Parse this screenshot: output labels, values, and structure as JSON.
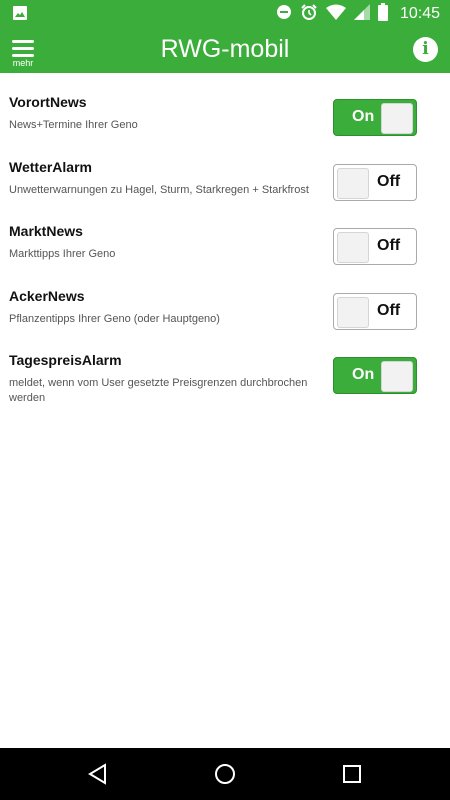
{
  "status_bar": {
    "time": "10:45",
    "icons": [
      "image-icon",
      "dnd-icon",
      "alarm-icon",
      "wifi-icon",
      "signal-icon",
      "battery-icon"
    ]
  },
  "app_bar": {
    "menu_label": "mehr",
    "title": "RWG-mobil",
    "info_icon": "info-icon"
  },
  "colors": {
    "brand_green": "#3aad3a",
    "nav_background": "#000000"
  },
  "settings": [
    {
      "title": "VorortNews",
      "description": "News+Termine Ihrer Geno",
      "state": "on",
      "toggle_label": "On"
    },
    {
      "title": "WetterAlarm",
      "description": "Unwetterwarnungen zu Hagel, Sturm, Starkregen + Starkfrost",
      "state": "off",
      "toggle_label": "Off"
    },
    {
      "title": "MarktNews",
      "description": "Markttipps Ihrer Geno",
      "state": "off",
      "toggle_label": "Off"
    },
    {
      "title": "AckerNews",
      "description": "Pflanzentipps Ihrer Geno (oder Hauptgeno)",
      "state": "off",
      "toggle_label": "Off"
    },
    {
      "title": "TagespreisAlarm",
      "description": "meldet, wenn vom User gesetzte Preisgrenzen durchbrochen werden",
      "state": "on",
      "toggle_label": "On"
    }
  ],
  "nav_bar": {
    "icons": [
      "back-icon",
      "home-icon",
      "recents-icon"
    ]
  }
}
